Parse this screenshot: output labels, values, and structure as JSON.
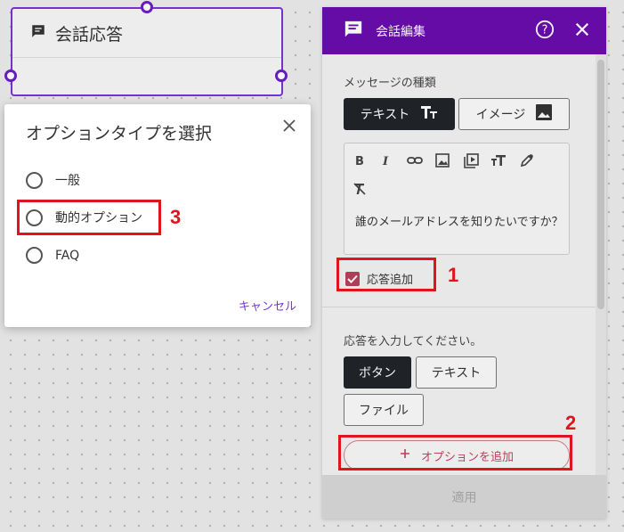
{
  "node": {
    "title": "会話応答"
  },
  "panel": {
    "title": "会話編集",
    "message_type_label": "メッセージの種類",
    "message_types": [
      "テキスト",
      "イメージ"
    ],
    "message_text": "誰のメールアドレスを知りたいですか？",
    "add_response_label": "応答追加",
    "add_response_checked": true,
    "response_prompt": "応答を入力してください。",
    "response_types": [
      "ボタン",
      "テキスト",
      "ファイル"
    ],
    "add_option_label": "オプションを追加",
    "apply_label": "適用",
    "accent_color": "#6a0dad"
  },
  "modal": {
    "title": "オプションタイプを選択",
    "options": [
      "一般",
      "動的オプション",
      "FAQ"
    ],
    "cancel_label": "キャンセル"
  },
  "annotations": {
    "n1": "1",
    "n2": "2",
    "n3": "3",
    "color": "#e0141e"
  }
}
